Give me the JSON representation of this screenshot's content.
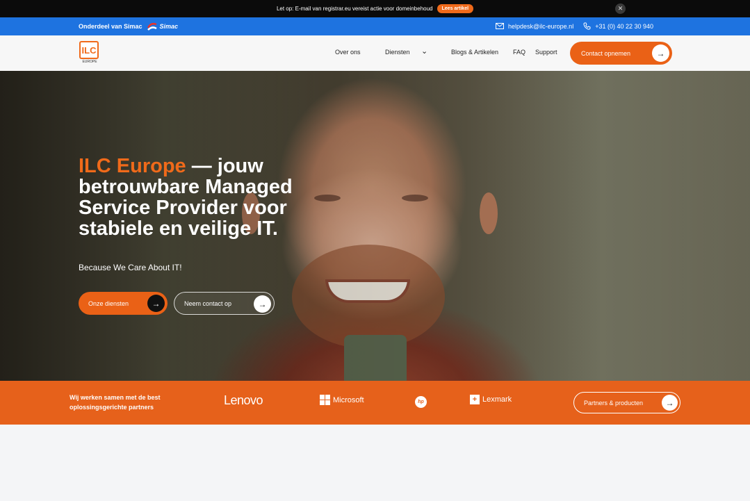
{
  "announcement": {
    "text": "Let op: E-mail van registrar.eu vereist actie voor domeinbehoud",
    "button_label": "Lees artikel",
    "close_glyph": "✕"
  },
  "parent_bar": {
    "label": "Onderdeel van Simac",
    "brand": "Simac",
    "email": "helpdesk@ilc-europe.nl",
    "phone": "+31 (0) 40 22 30 940",
    "icons": [
      "simac-logo-icon",
      "mail-icon",
      "phone-icon"
    ]
  },
  "nav": {
    "logo_text": "ILC",
    "logo_sub": "EUROPE",
    "items": [
      {
        "label": "Over ons"
      },
      {
        "label": "Diensten"
      },
      {
        "label": "Blogs & Artikelen"
      },
      {
        "label": "FAQ"
      },
      {
        "label": "Support"
      }
    ],
    "dropdown_glyph": "⌄",
    "cta_label": "Contact opnemen"
  },
  "hero": {
    "title_accent": "ILC Europe",
    "title_rest": " — jouw betrouwbare Managed Service Provider voor stabiele en veilige IT.",
    "subtitle": "Because We Care About IT!",
    "primary_button": "Onze diensten",
    "secondary_button": "Neem contact op",
    "arrow_glyph": "→"
  },
  "partners": {
    "intro": "Wij werken samen met de best oplossingsgerichte partners",
    "logos": [
      {
        "name": "Lenovo",
        "icon": "lenovo-logo"
      },
      {
        "name": "Microsoft",
        "icon": "microsoft-logo"
      },
      {
        "name": "hp",
        "icon": "hp-logo"
      },
      {
        "name": "Lexmark",
        "icon": "lexmark-logo"
      }
    ],
    "lexmark_mark": "+",
    "button_label": "Partners & producten"
  },
  "colors": {
    "accent": "#ea6116",
    "blue": "#1e73e0",
    "announce_bg": "#0b0b0b"
  }
}
